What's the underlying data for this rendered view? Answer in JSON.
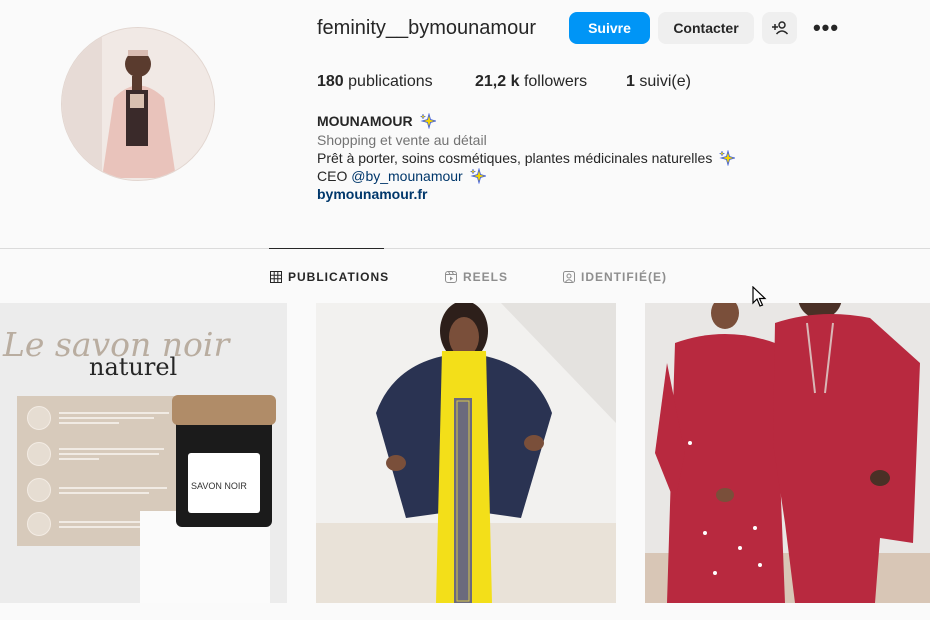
{
  "profile": {
    "username": "feminity__bymounamour",
    "follow_label": "Suivre",
    "contact_label": "Contacter",
    "more_label": "•••"
  },
  "stats": {
    "posts_count": "180",
    "posts_label": "publications",
    "followers_count": "21,2 k",
    "followers_label": "followers",
    "following_count": "1",
    "following_label": "suivi(e)"
  },
  "bio": {
    "name": "MOUNAMOUR",
    "category": "Shopping et vente au détail",
    "line1": "Prêt à porter, soins cosmétiques, plantes médicinales naturelles",
    "ceo_prefix": "CEO ",
    "ceo_handle": "@by_mounamour",
    "website": "bymounamour.fr"
  },
  "tabs": [
    {
      "label": "PUBLICATIONS",
      "icon": "grid-icon",
      "active": true
    },
    {
      "label": "REELS",
      "icon": "reels-icon",
      "active": false
    },
    {
      "label": "IDENTIFIÉ(E)",
      "icon": "tagged-icon",
      "active": false
    }
  ],
  "posts": [
    {
      "title": "Le savon noir",
      "subtitle": "naturel",
      "label": "SAVON NOIR"
    },
    {},
    {}
  ],
  "colors": {
    "accent": "#0095f6",
    "link": "#00376b",
    "secondary_text": "#737373",
    "sparkle": "#f5d400"
  }
}
